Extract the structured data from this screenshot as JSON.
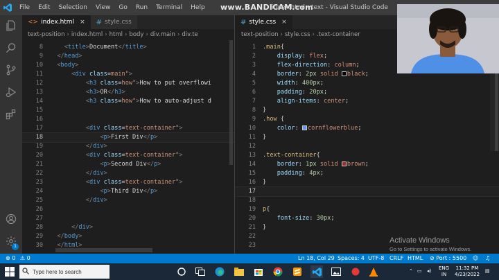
{
  "watermark": "www.BANDICAM.com",
  "window": {
    "title": "index.html - text - Visual Studio Code"
  },
  "menu": [
    "File",
    "Edit",
    "Selection",
    "View",
    "Go",
    "Run",
    "Terminal",
    "Help"
  ],
  "left_editor": {
    "tabs": [
      {
        "label": "index.html",
        "active": true
      },
      {
        "label": "style.css",
        "active": false
      }
    ],
    "breadcrumbs": [
      "text-position",
      "index.html",
      "html",
      "body",
      "div.main",
      "div.te"
    ],
    "current_line": "18",
    "lines": [
      {
        "n": "8",
        "code": "    <title>Document</title>"
      },
      {
        "n": "9",
        "code": "  </head>"
      },
      {
        "n": "10",
        "code": "  <body>"
      },
      {
        "n": "11",
        "code": "      <div class=\"main\">"
      },
      {
        "n": "12",
        "code": "          <h3 class=\"how\">How to put overflowi"
      },
      {
        "n": "13",
        "code": "          <h3>OR</h3>"
      },
      {
        "n": "14",
        "code": "          <h3 class=\"how\">How to auto-adjust d"
      },
      {
        "n": "15",
        "code": ""
      },
      {
        "n": "16",
        "code": ""
      },
      {
        "n": "17",
        "code": "          <div class=\"text-container\">"
      },
      {
        "n": "18",
        "code": "              <p>First Div</p>"
      },
      {
        "n": "19",
        "code": "          </div>"
      },
      {
        "n": "20",
        "code": "          <div class=\"text-container\">"
      },
      {
        "n": "21",
        "code": "              <p>Second Div</p>"
      },
      {
        "n": "22",
        "code": "          </div>"
      },
      {
        "n": "23",
        "code": "          <div class=\"text-container\">"
      },
      {
        "n": "24",
        "code": "              <p>Third Div</p>"
      },
      {
        "n": "25",
        "code": "          </div>"
      },
      {
        "n": "26",
        "code": ""
      },
      {
        "n": "27",
        "code": ""
      },
      {
        "n": "28",
        "code": "      </div>"
      },
      {
        "n": "29",
        "code": "  </body>"
      },
      {
        "n": "30",
        "code": "  </html>"
      }
    ]
  },
  "right_editor": {
    "tabs": [
      {
        "label": "style.css",
        "active": true
      }
    ],
    "breadcrumbs": [
      "text-position",
      "style.css",
      ".text-container"
    ],
    "current_line": "17",
    "lines": [
      {
        "n": "1",
        "code": ".main{"
      },
      {
        "n": "2",
        "code": "    display: flex;"
      },
      {
        "n": "3",
        "code": "    flex-direction: column;"
      },
      {
        "n": "4",
        "code": "    border: 2px solid black;",
        "swatch": "#000000"
      },
      {
        "n": "5",
        "code": "    width: 400px;"
      },
      {
        "n": "6",
        "code": "    padding: 20px;"
      },
      {
        "n": "7",
        "code": "    align-items: center;"
      },
      {
        "n": "8",
        "code": "}"
      },
      {
        "n": "9",
        "code": ".how {"
      },
      {
        "n": "10",
        "code": "    color: cornflowerblue;",
        "swatch": "#6495ed"
      },
      {
        "n": "11",
        "code": "}"
      },
      {
        "n": "12",
        "code": ""
      },
      {
        "n": "13",
        "code": ".text-container{"
      },
      {
        "n": "14",
        "code": "    border: 1px solid brown;",
        "swatch": "#a52a2a"
      },
      {
        "n": "15",
        "code": "    padding: 4px;"
      },
      {
        "n": "16",
        "code": "}"
      },
      {
        "n": "17",
        "code": ""
      },
      {
        "n": "18",
        "code": ""
      },
      {
        "n": "19",
        "code": "p{"
      },
      {
        "n": "20",
        "code": "    font-size: 30px;"
      },
      {
        "n": "21",
        "code": "}"
      },
      {
        "n": "22",
        "code": ""
      },
      {
        "n": "23",
        "code": ""
      }
    ]
  },
  "activity_bar": {
    "icons": [
      "files-icon",
      "search-icon",
      "source-control-icon",
      "run-debug-icon",
      "extensions-icon",
      "account-icon",
      "settings-gear-icon"
    ],
    "badge": "1"
  },
  "status_bar": {
    "errors": "0",
    "warnings": "0",
    "position": "Ln 18, Col 29",
    "spaces": "Spaces: 4",
    "encoding": "UTF-8",
    "eol": "CRLF",
    "language": "HTML",
    "port": "Port : 5500"
  },
  "activate_windows": {
    "title": "Activate Windows",
    "subtitle": "Go to Settings to activate Windows."
  },
  "taskbar": {
    "search_placeholder": "Type here to search",
    "lang_line1": "ENG",
    "lang_line2": "IN",
    "time": "11:32 PM",
    "date": "4/23/2022"
  },
  "colors": {
    "accent": "#007acc",
    "editor_bg": "#1e1e1e",
    "titlebar_bg": "#3c3c3c"
  }
}
